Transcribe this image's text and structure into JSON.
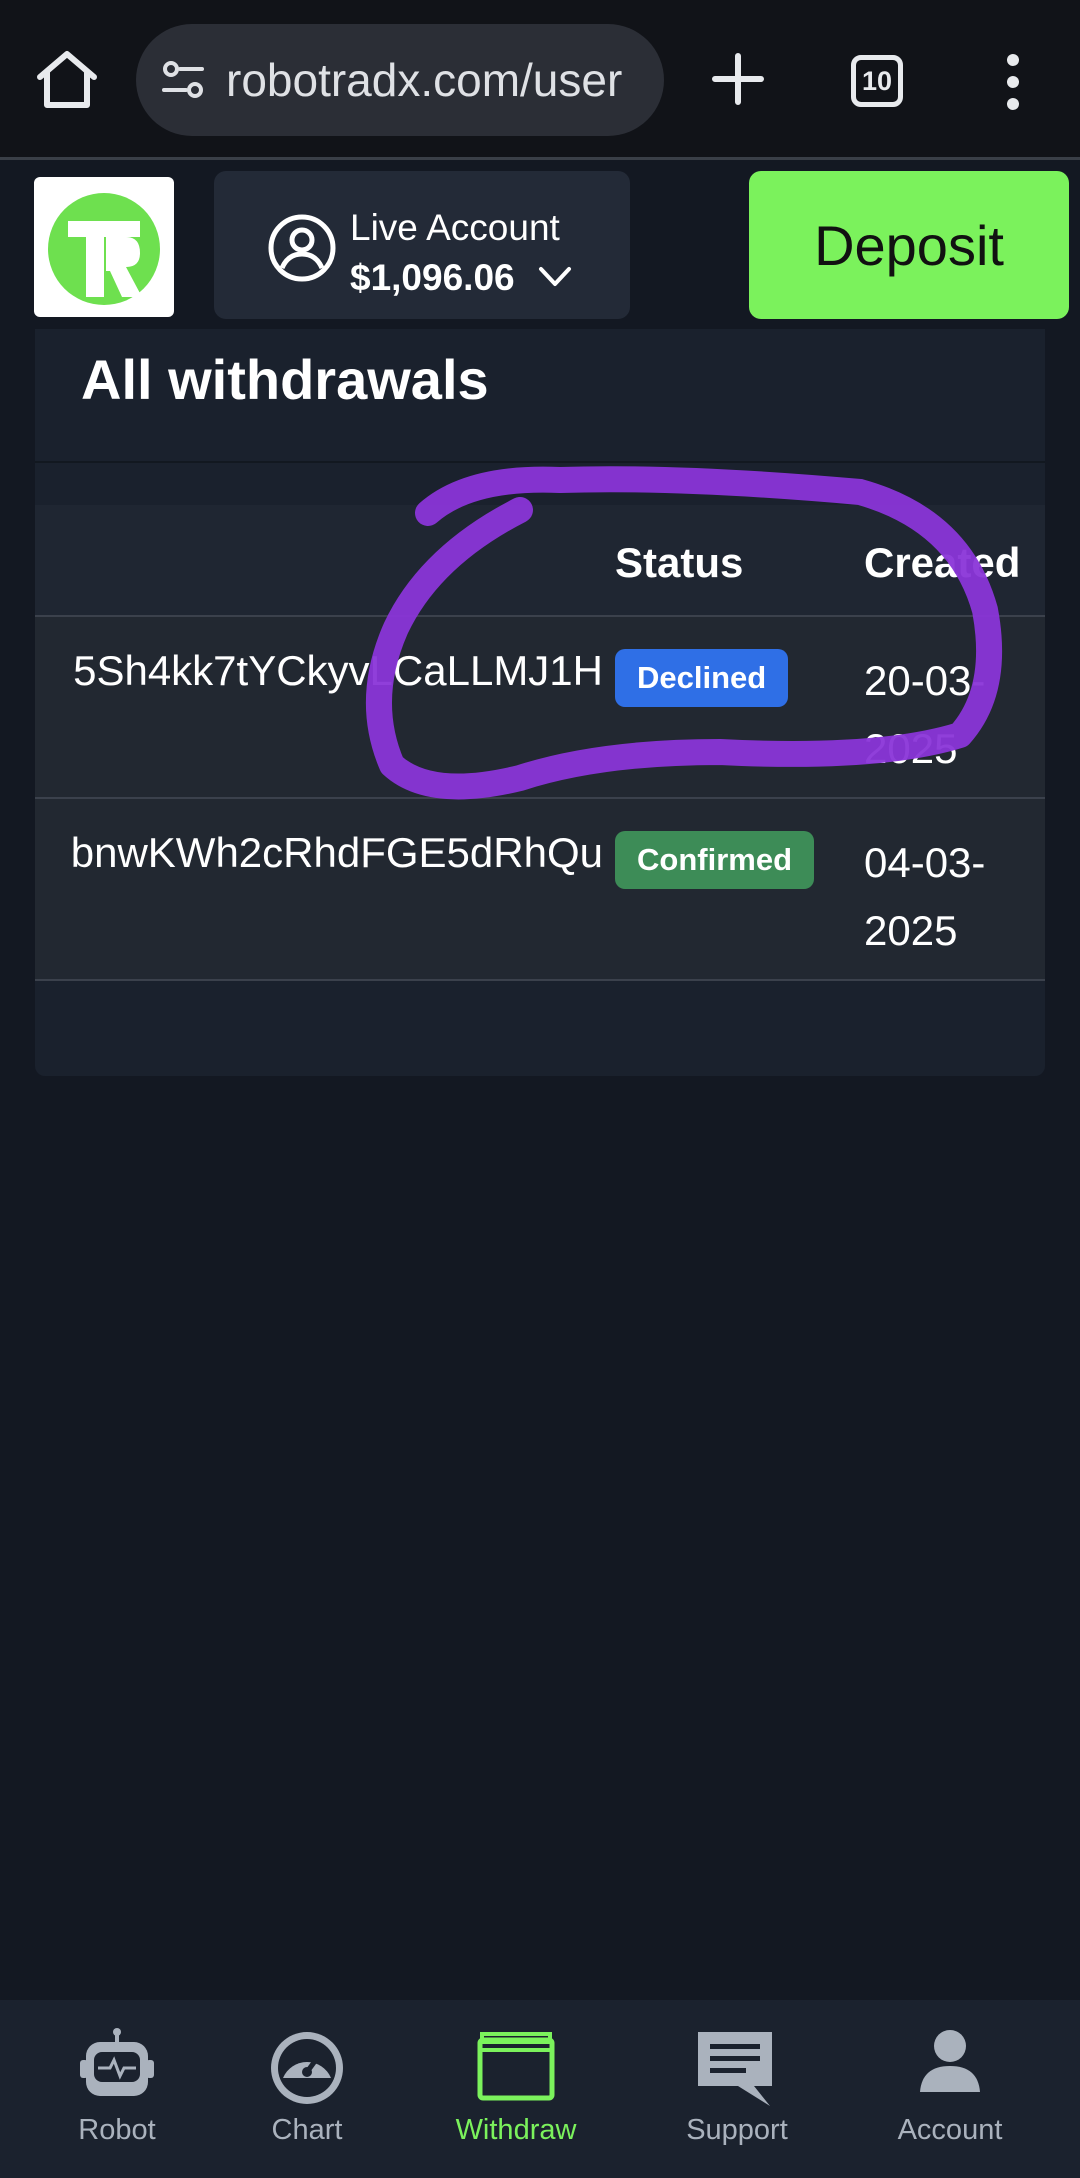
{
  "browser": {
    "url": "robotradx.com/user",
    "tab_count": "10"
  },
  "header": {
    "account_label": "Live Account",
    "balance": "$1,096.06",
    "deposit_label": "Deposit"
  },
  "page": {
    "title": "All withdrawals"
  },
  "table": {
    "columns": [
      "Status",
      "Created"
    ],
    "rows": [
      {
        "address": "5Sh4kk7tYCkyvLCaLLMJ1H",
        "status": "Declined",
        "created": "20-03-2025"
      },
      {
        "address": "bnwKWh2cRhdFGE5dRhQu",
        "status": "Confirmed",
        "created": "04-03-2025"
      }
    ]
  },
  "nav": {
    "items": [
      {
        "label": "Robot",
        "icon": "robot-icon"
      },
      {
        "label": "Chart",
        "icon": "speedometer-icon"
      },
      {
        "label": "Withdraw",
        "icon": "wallet-icon"
      },
      {
        "label": "Support",
        "icon": "chat-icon"
      },
      {
        "label": "Account",
        "icon": "person-icon"
      }
    ],
    "active": "Withdraw"
  },
  "colors": {
    "background": "#131822",
    "accent_green": "#7bf25c",
    "declined": "#2f6fe6",
    "confirmed": "#3d8c57",
    "annotation": "#8a35d8"
  }
}
